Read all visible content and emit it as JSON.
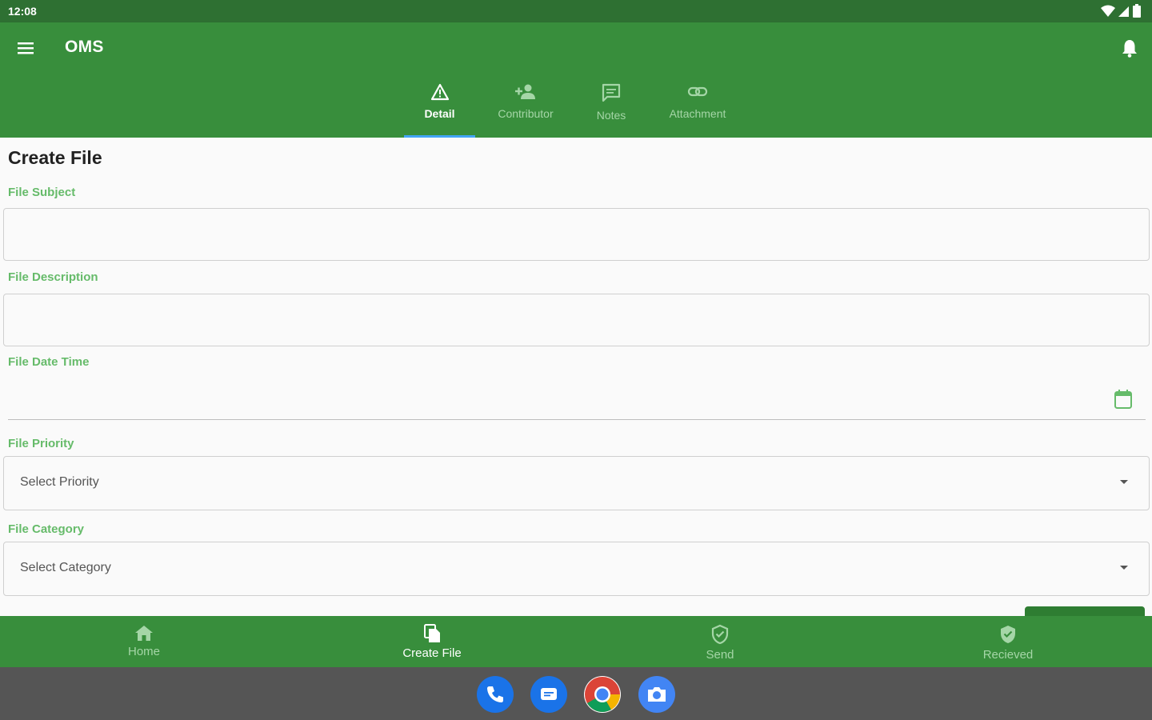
{
  "status_bar": {
    "time": "12:08"
  },
  "app_bar": {
    "title": "OMS"
  },
  "tabs": [
    {
      "label": "Detail",
      "icon": "warning-icon",
      "active": true
    },
    {
      "label": "Contributor",
      "icon": "person-add-icon",
      "active": false
    },
    {
      "label": "Notes",
      "icon": "chat-icon",
      "active": false
    },
    {
      "label": "Attachment",
      "icon": "link-icon",
      "active": false
    }
  ],
  "form": {
    "title": "Create File",
    "subject": {
      "label": "File Subject",
      "value": ""
    },
    "description": {
      "label": "File Description",
      "value": ""
    },
    "datetime": {
      "label": "File Date Time",
      "value": ""
    },
    "priority": {
      "label": "File Priority",
      "selected": "Select Priority"
    },
    "category": {
      "label": "File Category",
      "selected": "Select Category"
    }
  },
  "bottom_nav": [
    {
      "label": "Home",
      "icon": "home-icon",
      "active": false
    },
    {
      "label": "Create File",
      "icon": "file-copy-icon",
      "active": true
    },
    {
      "label": "Send",
      "icon": "shield-check-icon",
      "active": false
    },
    {
      "label": "Recieved",
      "icon": "verified-shield-icon",
      "active": false
    }
  ],
  "dock": [
    "phone-icon",
    "messages-icon",
    "chrome-icon",
    "camera-icon"
  ],
  "colors": {
    "primary": "#388e3c",
    "primary_dark": "#2e7032",
    "accent": "#42a5f5",
    "label": "#66bb6a"
  }
}
